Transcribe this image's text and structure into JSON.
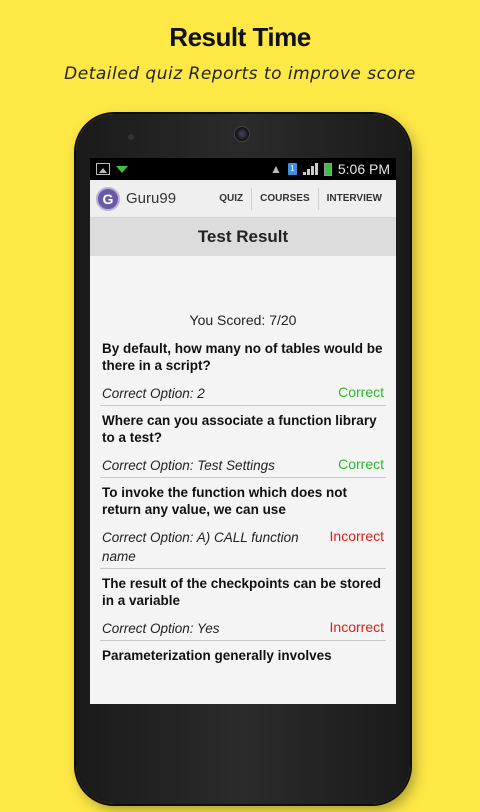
{
  "promo": {
    "title": "Result Time",
    "subtitle": "Detailed quiz Reports to improve score"
  },
  "statusbar": {
    "time": "5:06 PM",
    "icons": [
      "image-icon",
      "download-icon",
      "wifi-icon",
      "sim-icon",
      "signal-icon",
      "battery-icon"
    ]
  },
  "appbar": {
    "brand": "Guru99",
    "logo_letter": "G",
    "nav": [
      "QUIZ",
      "COURSES",
      "INTERVIEW"
    ]
  },
  "page": {
    "title": "Test Result",
    "score": "You Scored: 7/20"
  },
  "questions": [
    {
      "text": "By default, how many no of tables would be there in a script?",
      "answer": "Correct Option: 2",
      "status": "Correct"
    },
    {
      "text": "Where can you associate a function library to a test?",
      "answer": "Correct Option: Test Settings",
      "status": "Correct"
    },
    {
      "text": "To invoke the function which does not return any value, we can use",
      "answer": "Correct Option: A) CALL function name",
      "status": "Incorrect"
    },
    {
      "text": "The result of the checkpoints can be stored in a variable",
      "answer": "Correct Option: Yes",
      "status": "Incorrect"
    },
    {
      "text": "Parameterization generally involves",
      "answer": "",
      "status": ""
    }
  ],
  "colors": {
    "background": "#FDE846",
    "correct": "#2db92d",
    "incorrect": "#d62020",
    "logo": "#6a5aa6"
  }
}
